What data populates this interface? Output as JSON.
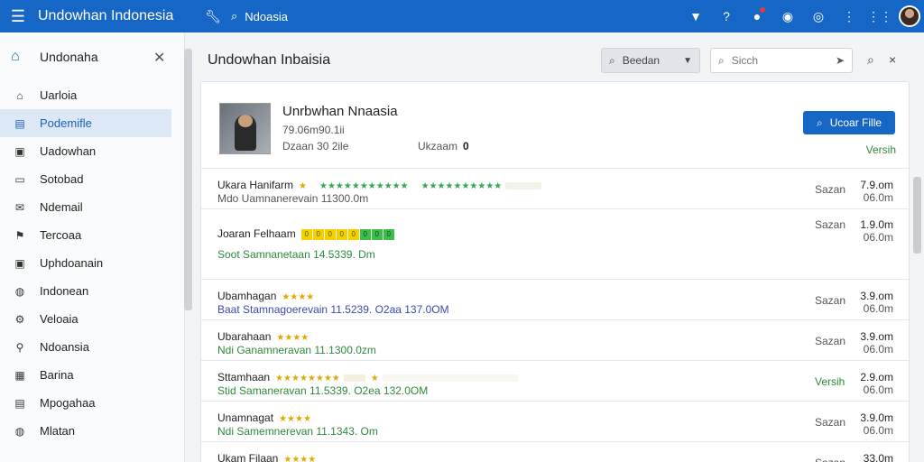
{
  "topbar": {
    "app_title": "Undowhan Indonesia",
    "search_text": "Ndoasia"
  },
  "sidebar": {
    "header": "Undonaha",
    "items": [
      {
        "label": "Uarloia",
        "icon": "home-icon",
        "active": false
      },
      {
        "label": "Podemifle",
        "icon": "chart-icon",
        "active": true
      },
      {
        "label": "Uadowhan",
        "icon": "image-icon",
        "active": false
      },
      {
        "label": "Sotobad",
        "icon": "monitor-icon",
        "active": false
      },
      {
        "label": "Ndemail",
        "icon": "mail-icon",
        "active": false
      },
      {
        "label": "Tercoaa",
        "icon": "flag-icon",
        "active": false
      },
      {
        "label": "Uphdoanain",
        "icon": "image-icon",
        "active": false
      },
      {
        "label": "Indonean",
        "icon": "globe-icon",
        "active": false
      },
      {
        "label": "Veloaia",
        "icon": "gear-icon",
        "active": false
      },
      {
        "label": "Ndoansia",
        "icon": "pin-icon",
        "active": false
      },
      {
        "label": "Barina",
        "icon": "grid-icon",
        "active": false
      },
      {
        "label": "Mpogahaa",
        "icon": "document-icon",
        "active": false
      },
      {
        "label": "Mlatan",
        "icon": "globe-icon",
        "active": false
      }
    ]
  },
  "main": {
    "title": "Undowhan Inbaisia",
    "dropdown_label": "Beedan",
    "search_placeholder": "Sicch"
  },
  "product": {
    "name": "Unrbwhan Nnaasia",
    "id": "79.06m90.1ii",
    "meta1": "Dzaan 30 2ile",
    "meta2_label": "Ukzaam",
    "meta2_value": "0",
    "primary_button": "Ucoar Fille",
    "version": "Versih"
  },
  "rows": [
    {
      "title": "Ukara Hanifarm",
      "subtitle": "Mdo Uamnanerevain 11300.0m",
      "sub_style": "",
      "status": "Sazan",
      "v1": "7.9.om",
      "v2": "06.0m"
    },
    {
      "title": "Joaran Felhaam",
      "subtitle": "Soot Samnanetaan 14.5339. Dm",
      "sub_style": "green",
      "status": "Sazan",
      "v1": "1.9.0m",
      "v2": "06.0m"
    },
    {
      "title": "Ubamhagan",
      "subtitle": "Baat Stamnagoerevain 11.5239. O2aa 137.0OM",
      "sub_style": "blue",
      "status": "Sazan",
      "v1": "3.9.om",
      "v2": "06.0m"
    },
    {
      "title": "Ubarahaan",
      "subtitle": "Ndi Ganamneravan 11.1300.0zm",
      "sub_style": "green",
      "status": "Sazan",
      "v1": "3.9.om",
      "v2": "06.0m"
    },
    {
      "title": "Sttamhaan",
      "subtitle": "Stid Samaneravan 11.5339. O2ea 132.0OM",
      "sub_style": "green",
      "status": "Versih",
      "status_style": "green",
      "v1": "2.9.om",
      "v2": "06.0m"
    },
    {
      "title": "Unamnagat",
      "subtitle": "Ndi Samemnerevan 11.1343. Om",
      "sub_style": "green",
      "status": "Sazan",
      "v1": "3.9.0m",
      "v2": "06.0m"
    },
    {
      "title": "Ukam Filaan",
      "subtitle": "",
      "sub_style": "",
      "status": "Sazan",
      "v1": "33.0m",
      "v2": ""
    }
  ],
  "colors": {
    "brand": "#1666c5",
    "success": "#2e8b3a",
    "rating": "#e0a800"
  }
}
